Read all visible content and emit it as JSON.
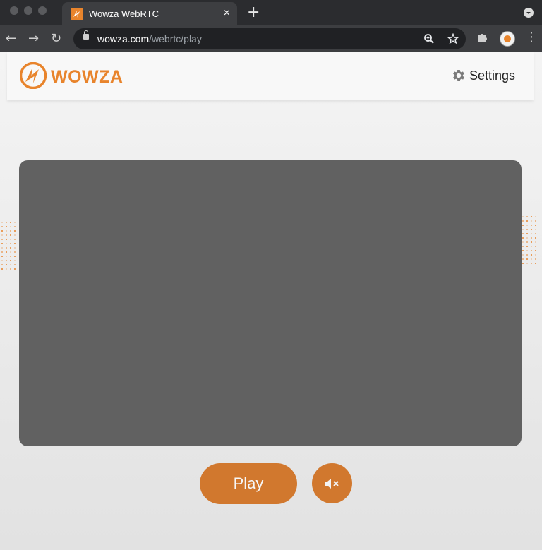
{
  "browser": {
    "tab_title": "Wowza WebRTC",
    "tab_close": "×",
    "new_tab": "+",
    "url_host": "wowza.com",
    "url_path": "/webrtc/play"
  },
  "header": {
    "logo_text": "WOWZA",
    "settings_label": "Settings"
  },
  "controls": {
    "play_label": "Play",
    "mute_state": "muted"
  },
  "colors": {
    "brand": "#e8842c",
    "button": "#d1782e",
    "video_bg": "#616161"
  },
  "icons": [
    "lock-icon",
    "zoom-icon",
    "star-icon",
    "extensions-icon",
    "gear-icon",
    "muted-speaker-icon"
  ]
}
